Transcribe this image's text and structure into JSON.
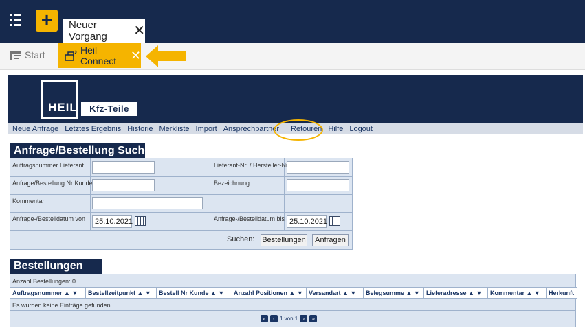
{
  "app_bar": {
    "tab_title": "Neuer Vorgang",
    "tab_close": "✕"
  },
  "tabs": {
    "start_label": "Start",
    "active_label": "Heil Connect",
    "active_close": "✕"
  },
  "logo": {
    "brand": "HEIL",
    "tagline": "Kfz-Teile"
  },
  "nav": {
    "items": [
      "Neue Anfrage",
      "Letztes Ergebnis",
      "Historie",
      "Merkliste",
      "Import",
      "Ansprechpartner",
      "Retouren",
      "Hilfe",
      "Logout"
    ]
  },
  "search": {
    "title": "Anfrage/Bestellung Suchen",
    "labels": {
      "auftragsnummer": "Auftragsnummer Lieferant",
      "lieferant_nr": "Lieferant-Nr. / Hersteller-Nr.",
      "anfrage_nr": "Anfrage/Bestellung Nr Kunde",
      "bezeichnung": "Bezeichnung",
      "kommentar": "Kommentar",
      "datum_von": "Anfrage-/Bestelldatum von",
      "datum_bis": "Anfrage-/Bestelldatum bis",
      "suchen": "Suchen:"
    },
    "values": {
      "datum_von": "25.10.2021",
      "datum_bis": "25.10.2021"
    },
    "buttons": {
      "bestellungen": "Bestellungen",
      "anfragen": "Anfragen"
    }
  },
  "results": {
    "title": "Bestellungen",
    "count_label": "Anzahl Bestellungen: 0",
    "columns": [
      "Auftragsnummer ▲ ▼",
      "Bestellzeitpunkt ▲ ▼",
      "Bestell Nr Kunde ▲ ▼",
      "Anzahl Positionen ▲ ▼",
      "Versandart ▲ ▼",
      "Belegsumme ▲ ▼",
      "Lieferadresse ▲ ▼",
      "Kommentar ▲ ▼",
      "Herkunft"
    ],
    "empty_message": "Es wurden keine Einträge gefunden",
    "pager_text": "1 von 1"
  },
  "colors": {
    "navy": "#16294d",
    "accent": "#f5b400",
    "panel": "#dce5f1"
  }
}
